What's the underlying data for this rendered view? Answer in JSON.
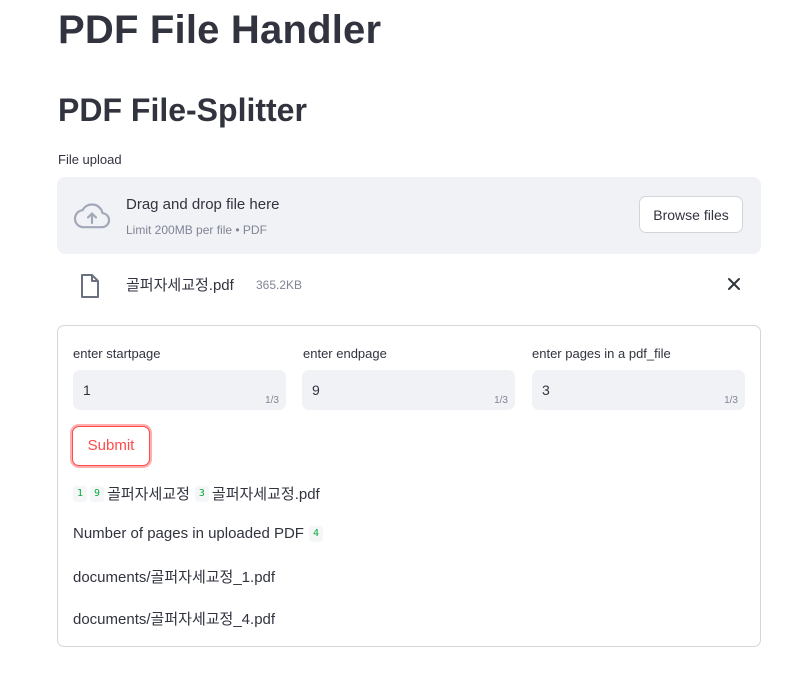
{
  "header": {
    "title": "PDF File Handler",
    "subtitle": "PDF File-Splitter"
  },
  "uploader": {
    "label": "File upload",
    "drop_text": "Drag and drop file here",
    "limit_text": "Limit 200MB per file • PDF",
    "browse_label": "Browse files",
    "upload_icon": "cloud-upload-icon"
  },
  "file": {
    "name": "골퍼자세교정.pdf",
    "size": "365.2KB",
    "file_icon": "file-icon",
    "remove_icon": "close-icon"
  },
  "form": {
    "fields": [
      {
        "label": "enter startpage",
        "value": "1",
        "counter": "1/3"
      },
      {
        "label": "enter endpage",
        "value": "9",
        "counter": "1/3"
      },
      {
        "label": "enter pages in a pdf_file",
        "value": "3",
        "counter": "1/3"
      }
    ],
    "submit_label": "Submit"
  },
  "output": {
    "line1": {
      "badge_start": "1",
      "badge_end": "9",
      "name": "골퍼자세교정",
      "badge_pages": "3",
      "filename": "골퍼자세교정.pdf"
    },
    "line2": {
      "text": "Number of pages in uploaded PDF",
      "badge": "4"
    },
    "line3": "documents/골퍼자세교정_1.pdf",
    "line4": "documents/골퍼자세교정_4.pdf"
  },
  "colors": {
    "accent": "#ff4b4b",
    "dropzone_bg": "#f0f2f6",
    "badge_text": "#09ab3b",
    "text": "#31333f",
    "muted": "#808495"
  }
}
